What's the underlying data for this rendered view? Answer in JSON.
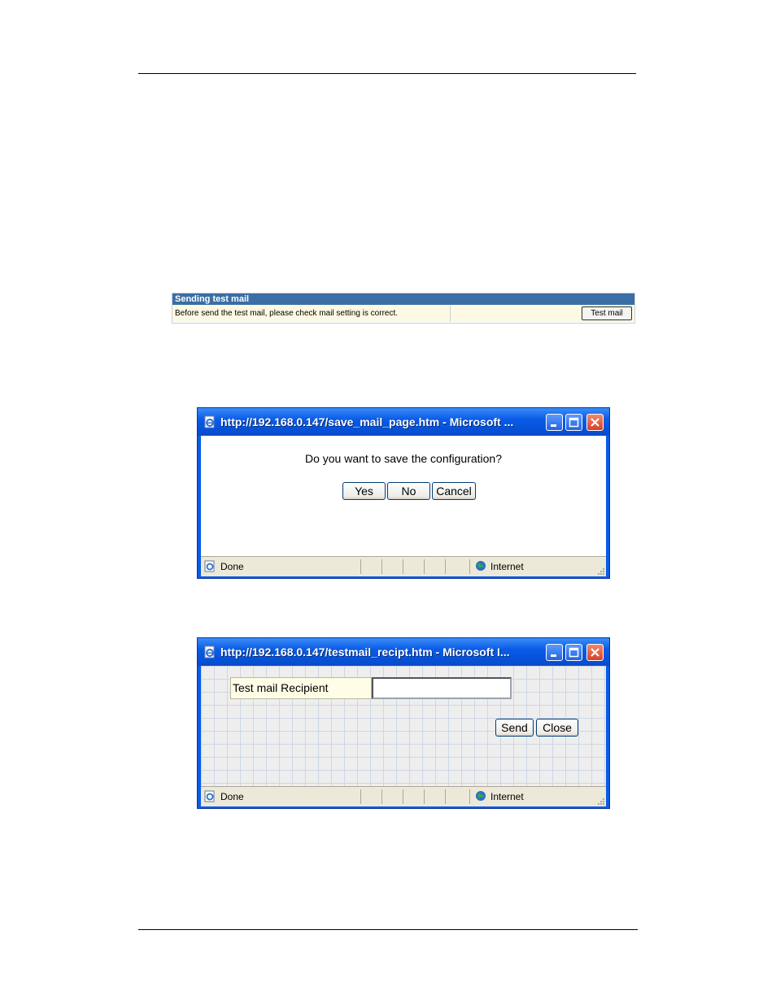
{
  "panel": {
    "title": "Sending test mail",
    "description": "Before send the test mail, please check mail setting is correct.",
    "test_mail_label": "Test mail"
  },
  "save_dialog": {
    "title": "http://192.168.0.147/save_mail_page.htm - Microsoft ...",
    "question": "Do you want to save the configuration?",
    "yes_label": "Yes",
    "no_label": "No",
    "cancel_label": "Cancel",
    "status_text": "Done",
    "zone_text": "Internet"
  },
  "recipient_dialog": {
    "title": "http://192.168.0.147/testmail_recipt.htm - Microsoft I...",
    "recipient_label": "Test mail Recipient",
    "recipient_value": "",
    "send_label": "Send",
    "close_label": "Close",
    "status_text": "Done",
    "zone_text": "Internet"
  },
  "colors": {
    "title_bar": "#0a5ce8",
    "panel_header": "#3a6ea5",
    "panel_row": "#fdf9e3"
  }
}
